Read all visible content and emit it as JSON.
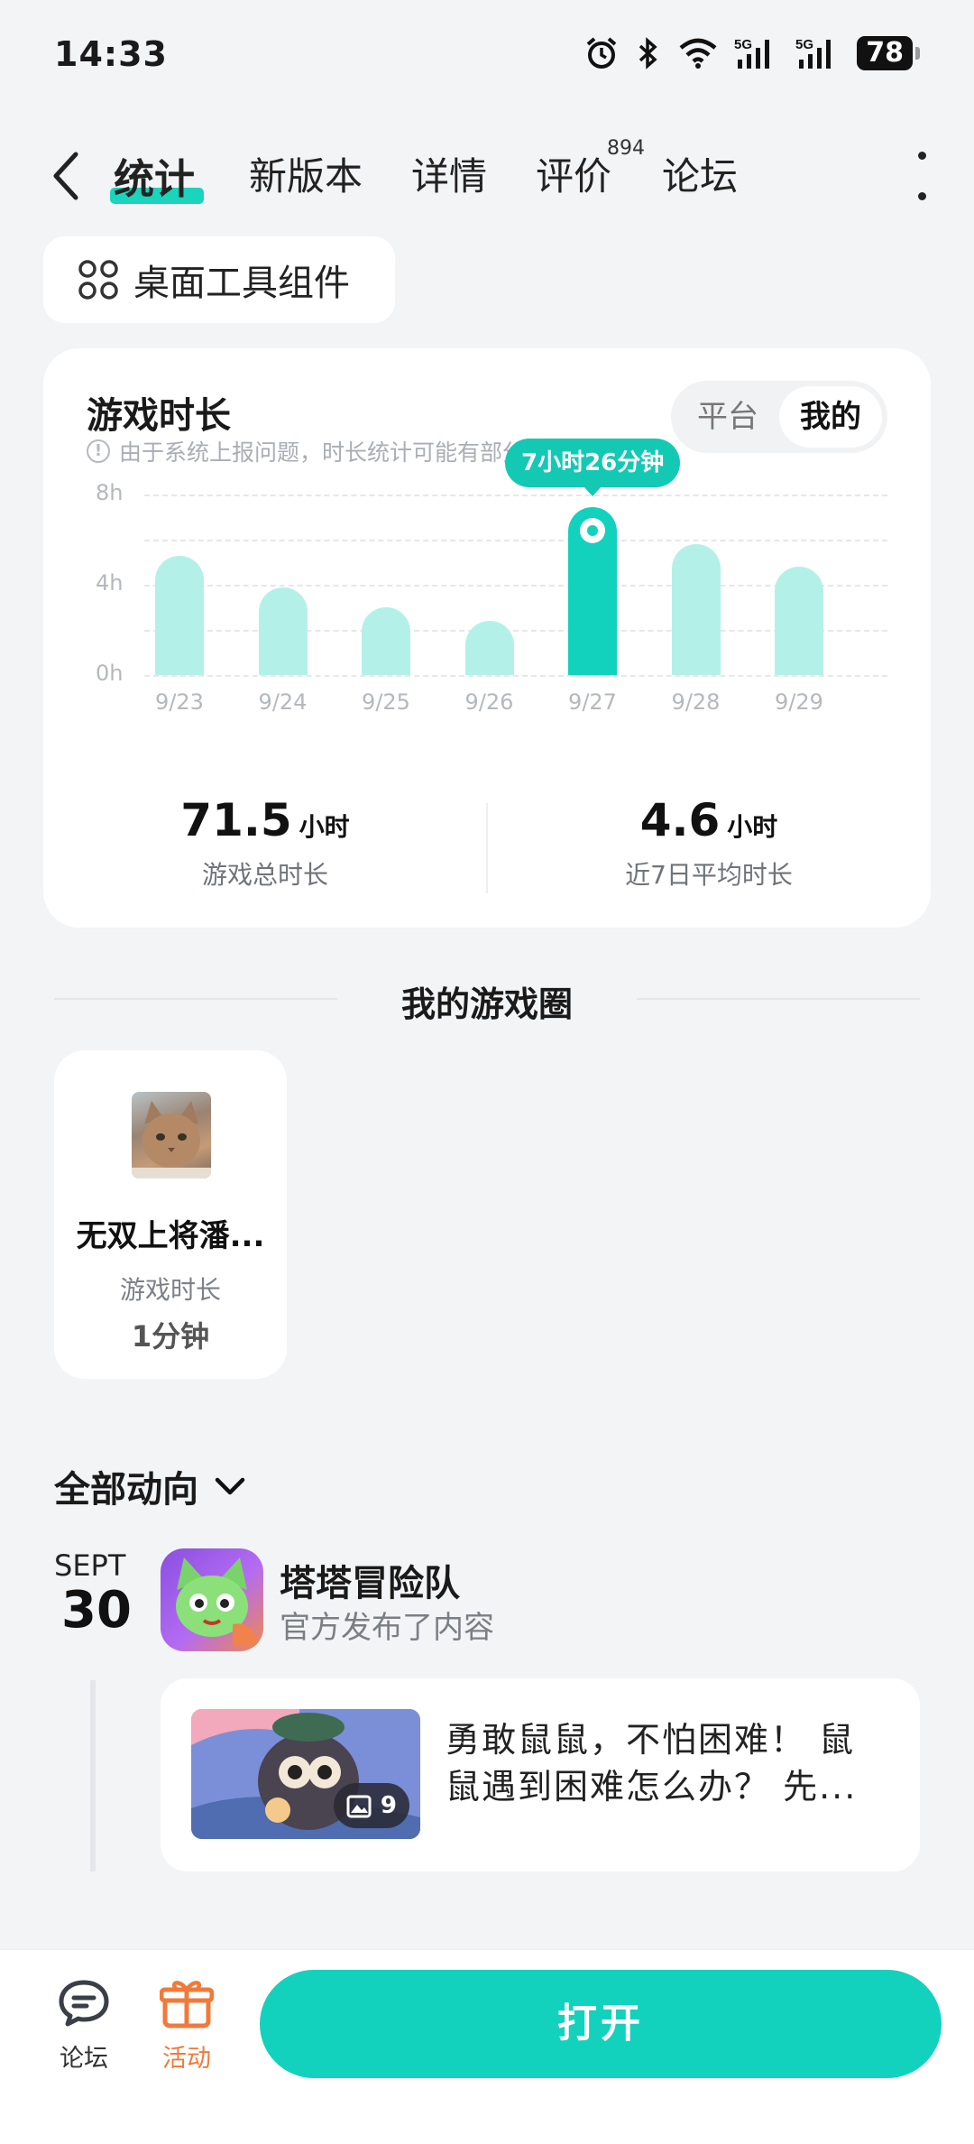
{
  "status_bar": {
    "time": "14:33",
    "battery": "78"
  },
  "nav": {
    "tabs": [
      "统计",
      "新版本",
      "详情",
      "评价",
      "论坛"
    ],
    "review_count": "894"
  },
  "widget_button": {
    "label": "桌面工具组件"
  },
  "stats": {
    "title": "游戏时长",
    "note": "由于系统上报问题，时长统计可能有部分缺失",
    "toggle": [
      "平台",
      "我的"
    ],
    "toggle_selected": "我的",
    "tooltip": "7小时26分钟",
    "total_value": "71.5",
    "total_unit": "小时",
    "total_label": "游戏总时长",
    "avg_value": "4.6",
    "avg_unit": "小时",
    "avg_label": "近7日平均时长"
  },
  "chart_data": {
    "type": "bar",
    "categories": [
      "9/23",
      "9/24",
      "9/25",
      "9/26",
      "9/27",
      "9/28",
      "9/29"
    ],
    "values": [
      5.3,
      3.9,
      3.0,
      2.4,
      7.43,
      5.8,
      4.8
    ],
    "y_ticks": [
      "8h",
      "4h",
      "0h"
    ],
    "ylim": [
      0,
      8
    ],
    "highlight_index": 4,
    "grid": true,
    "colors": {
      "bar": "#b3f1e8",
      "highlight": "#12d2bd"
    }
  },
  "game_circle": {
    "title": "我的游戏圈",
    "item": {
      "name": "无双上将潘...",
      "label": "游戏时长",
      "value": "1分钟"
    }
  },
  "activity": {
    "filter_label": "全部动向",
    "month": "SEPT",
    "day": "30",
    "app_name": "塔塔冒险队",
    "app_subtitle": "官方发布了内容",
    "post_text": "勇敢鼠鼠，不怕困难！ 鼠鼠遇到困难怎么办？ 先...",
    "image_count": "9"
  },
  "bottom_bar": {
    "forum_label": "论坛",
    "event_label": "活动",
    "open_label": "打开",
    "colors": {
      "accent": "#12d2bd",
      "event": "#f07a3a"
    }
  }
}
